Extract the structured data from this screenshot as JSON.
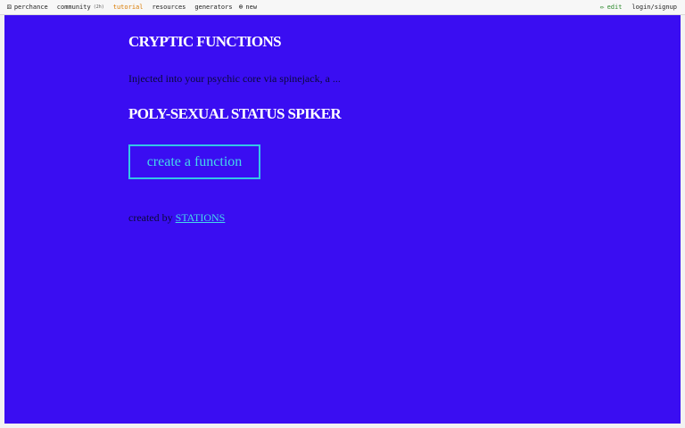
{
  "topbar": {
    "left_items": [
      {
        "icon": "dice-icon",
        "glyph": "⚄",
        "label": "perchance"
      },
      {
        "icon": "community-icon",
        "glyph": "",
        "label": "community",
        "badge": "(2h)"
      },
      {
        "icon": "tutorial-icon",
        "glyph": "",
        "label": "tutorial"
      },
      {
        "icon": "resources-icon",
        "glyph": "",
        "label": "resources"
      },
      {
        "icon": "generators-icon",
        "glyph": "",
        "label": "generators"
      },
      {
        "icon": "new-icon",
        "glyph": "⊕",
        "label": "new"
      }
    ],
    "right_items": [
      {
        "icon": "pencil-icon",
        "glyph": "✏",
        "label": "edit"
      },
      {
        "icon": "login-icon",
        "glyph": "",
        "label": "login/signup"
      }
    ]
  },
  "main": {
    "heading": "CRYPTIC FUNCTIONS",
    "description": "Injected into your psychic core via spinejack, a ...",
    "result": "POLY-SEXUAL STATUS SPIKER",
    "button_label": "create a function",
    "credit_prefix": "created by",
    "credit_link": "STATIONS"
  },
  "colors": {
    "background": "#3a0df2",
    "heading": "#ffffff",
    "accent": "#44d8ea",
    "tutorial": "#d97a00",
    "edit": "#2e8b2e"
  }
}
